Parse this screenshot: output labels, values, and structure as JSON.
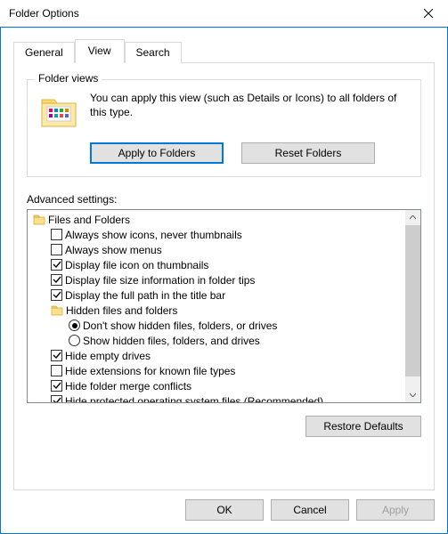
{
  "window": {
    "title": "Folder Options"
  },
  "tabs": {
    "general": "General",
    "view": "View",
    "search": "Search"
  },
  "folderViews": {
    "groupTitle": "Folder views",
    "description": "You can apply this view (such as Details or Icons) to all folders of this type.",
    "applyBtn": "Apply to Folders",
    "resetBtn": "Reset Folders"
  },
  "advanced": {
    "label": "Advanced settings:",
    "items": [
      {
        "type": "folder",
        "indent": 0,
        "label": "Files and Folders"
      },
      {
        "type": "check",
        "indent": 1,
        "checked": false,
        "label": "Always show icons, never thumbnails"
      },
      {
        "type": "check",
        "indent": 1,
        "checked": false,
        "label": "Always show menus"
      },
      {
        "type": "check",
        "indent": 1,
        "checked": true,
        "label": "Display file icon on thumbnails"
      },
      {
        "type": "check",
        "indent": 1,
        "checked": true,
        "label": "Display file size information in folder tips"
      },
      {
        "type": "check",
        "indent": 1,
        "checked": true,
        "label": "Display the full path in the title bar"
      },
      {
        "type": "folder",
        "indent": 1,
        "label": "Hidden files and folders"
      },
      {
        "type": "radio",
        "indent": 2,
        "checked": true,
        "label": "Don't show hidden files, folders, or drives"
      },
      {
        "type": "radio",
        "indent": 2,
        "checked": false,
        "label": "Show hidden files, folders, and drives"
      },
      {
        "type": "check",
        "indent": 1,
        "checked": true,
        "label": "Hide empty drives"
      },
      {
        "type": "check",
        "indent": 1,
        "checked": false,
        "label": "Hide extensions for known file types"
      },
      {
        "type": "check",
        "indent": 1,
        "checked": true,
        "label": "Hide folder merge conflicts"
      },
      {
        "type": "check",
        "indent": 1,
        "checked": true,
        "label": "Hide protected operating system files (Recommended)"
      }
    ],
    "restoreBtn": "Restore Defaults"
  },
  "dialogButtons": {
    "ok": "OK",
    "cancel": "Cancel",
    "apply": "Apply"
  }
}
